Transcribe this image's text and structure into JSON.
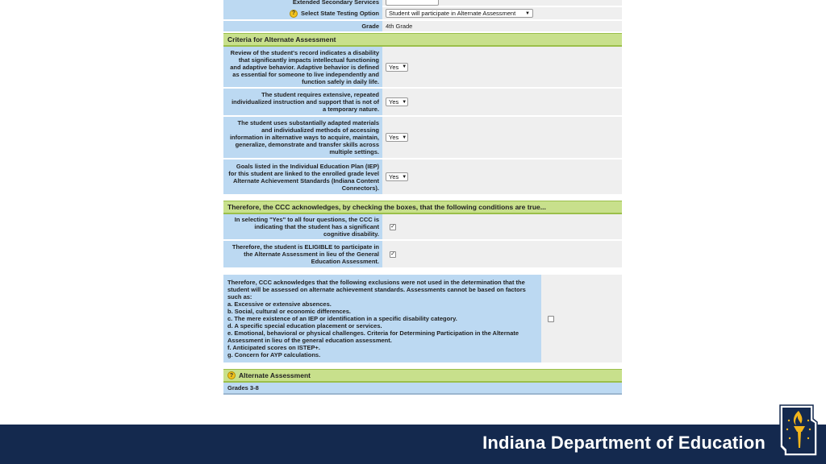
{
  "top_partial_label": "Extended Secondary Services",
  "testing": {
    "label": "Select State Testing Option",
    "value": "Student will participate in Alternate Assessment"
  },
  "grade": {
    "label": "Grade",
    "value": "4th Grade"
  },
  "criteria": {
    "title": "Criteria for Alternate Assessment",
    "rows": [
      {
        "text": "Review of the student's record indicates a disability that significantly impacts intellectual functioning and adaptive behavior. Adaptive behavior is defined as essential for someone to live independently and function safely in daily life.",
        "value": "Yes"
      },
      {
        "text": "The student requires extensive, repeated individualized instruction and support that is not of a temporary nature.",
        "value": "Yes"
      },
      {
        "text": "The student uses substantially adapted materials and individualized methods of accessing information in alternative ways to acquire, maintain, generalize, demonstrate and transfer skills across multiple settings.",
        "value": "Yes"
      },
      {
        "text": "Goals listed in the Individual Education Plan (IEP) for this student are linked to the enrolled grade level Alternate Achievement Standards (Indiana Content Connectors).",
        "value": "Yes"
      }
    ]
  },
  "acknowledge": {
    "title": "Therefore, the CCC acknowledges, by checking the boxes, that the following conditions are true...",
    "rows": [
      {
        "text": "In selecting \"Yes\" to all four questions, the CCC is indicating that the student has a significant cognitive disability.",
        "checked": true
      },
      {
        "text": "Therefore, the student is ELIGIBLE to participate in the Alternate Assessment in lieu of the General Education Assessment.",
        "checked": true
      }
    ]
  },
  "exclusions": {
    "intro": "Therefore, CCC acknowledges that the following exclusions were not used in the determination that the student will be assessed on alternate achievement standards. Assessments cannot be based on factors such as:",
    "items": [
      "a. Excessive or extensive absences.",
      "b. Social, cultural or economic differences.",
      "c. The mere existence of an IEP or identification in a specific disability category.",
      "d. A specific special education placement or services.",
      "e. Emotional, behavioral or physical challenges. Criteria for Determining Participation in the Alternate Assessment in lieu of the general education assessment.",
      "f. Anticipated scores on ISTEP+.",
      "g. Concern for AYP calculations."
    ],
    "checked": false
  },
  "alternate": {
    "title": "Alternate Assessment",
    "grades_label": "Grades 3-8"
  },
  "footer": {
    "brand": "Indiana Department of Education"
  },
  "colors": {
    "label_bg": "#bcd9f2",
    "section_bg": "#c8e08c",
    "footer_bg": "#14294e",
    "logo_gold": "#f2b51c"
  },
  "icons": {
    "help": "help-question-icon",
    "logo": "indiana-torch-logo"
  }
}
